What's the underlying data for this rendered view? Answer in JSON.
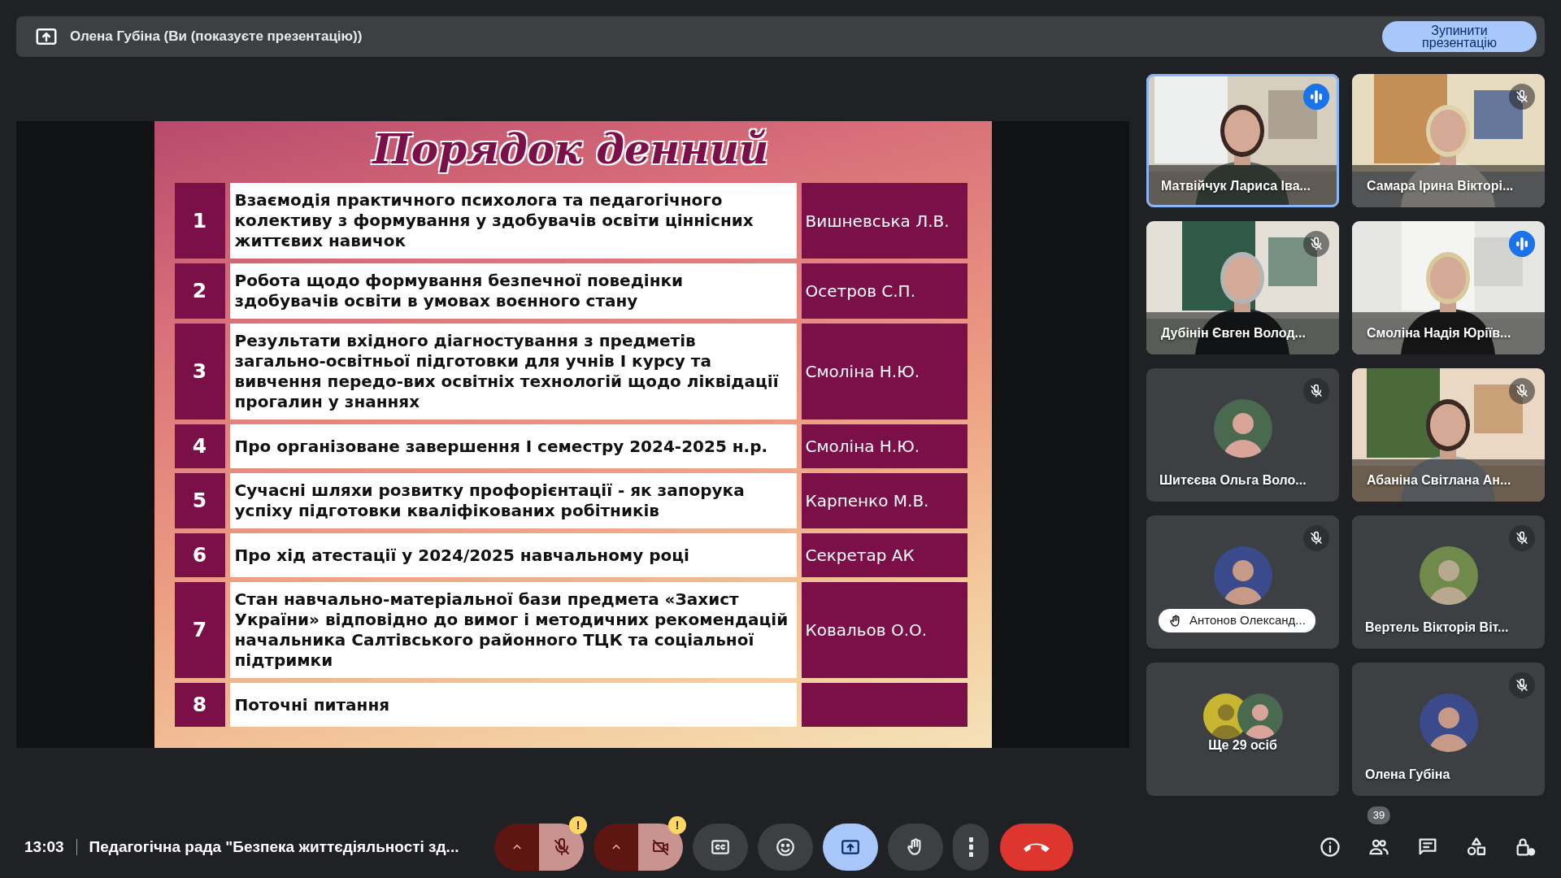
{
  "presenting_bar": {
    "text": "Олена Губіна (Ви (показуєте презентацію))",
    "stop_button": "Зупинити презентацію"
  },
  "slide": {
    "title": "Порядок денний",
    "agenda": [
      {
        "number": "1",
        "topic": "Взаємодія практичного психолога та педагогічного колективу з формування у здобувачів освіти ціннісних життєвих навичок",
        "speaker": "Вишневська Л.В."
      },
      {
        "number": "2",
        "topic": "Робота щодо формування безпечної поведінки здобувачів освіти в умовах воєнного стану",
        "speaker": "Осетров С.П."
      },
      {
        "number": "3",
        "topic": "Результати вхідного діагностування з предметів загально-освітньої підготовки для учнів І курсу та вивчення передо-вих освітніх технологій щодо ліквідації прогалин у знаннях",
        "speaker": "Смоліна Н.Ю."
      },
      {
        "number": "4",
        "topic": "Про організоване завершення І семестру 2024-2025 н.р.",
        "speaker": "Смоліна Н.Ю."
      },
      {
        "number": "5",
        "topic": "Сучасні шляхи розвитку профорієнтації - як запорука успіху підготовки кваліфікованих робітників",
        "speaker": "Карпенко М.В."
      },
      {
        "number": "6",
        "topic": "Про хід атестації у 2024/2025 навчальному році",
        "speaker": "Секретар АК"
      },
      {
        "number": "7",
        "topic": "Стан навчально-матеріальної бази предмета «Захист України» відповідно до вимог і методичних рекомендацій начальника Салтівського районного ТЦК та соціальної підтримки",
        "speaker": "Ковальов О.О."
      },
      {
        "number": "8",
        "topic": "Поточні питання"
      }
    ]
  },
  "participants": [
    {
      "name": "Матвійчук Лариса Іва...",
      "kind": "video",
      "speaking": true,
      "muted": false,
      "highlighted": true,
      "hand_raised": false
    },
    {
      "name": "Самара Ірина Вікторі...",
      "kind": "video",
      "speaking": false,
      "muted": true,
      "highlighted": false,
      "hand_raised": false
    },
    {
      "name": "Дубінін Євген Волод...",
      "kind": "video",
      "speaking": false,
      "muted": true,
      "highlighted": false,
      "hand_raised": false
    },
    {
      "name": "Смоліна Надія Юріїв...",
      "kind": "video",
      "speaking": true,
      "muted": false,
      "highlighted": false,
      "hand_raised": false
    },
    {
      "name": "Шитєєва Ольга Воло...",
      "kind": "avatar",
      "speaking": false,
      "muted": true,
      "highlighted": false,
      "hand_raised": false
    },
    {
      "name": "Абаніна Світлана Ан...",
      "kind": "video",
      "speaking": false,
      "muted": true,
      "highlighted": false,
      "hand_raised": false
    },
    {
      "name": "Антонов Олександ...",
      "kind": "avatar",
      "speaking": false,
      "muted": true,
      "highlighted": false,
      "hand_raised": true
    },
    {
      "name": "Вертель Вікторія Віт...",
      "kind": "avatar",
      "speaking": false,
      "muted": true,
      "highlighted": false,
      "hand_raised": false
    },
    {
      "name": "Ще 29 осіб",
      "kind": "group",
      "speaking": false,
      "muted": false,
      "highlighted": false,
      "hand_raised": false
    },
    {
      "name": "Олена Губіна",
      "kind": "avatar",
      "speaking": false,
      "muted": true,
      "highlighted": false,
      "hand_raised": false
    }
  ],
  "bottom_bar": {
    "time": "13:03",
    "meeting_title": "Педагогічна рада \"Безпека життєдіяльності зд...",
    "controls": [
      {
        "kind": "mic",
        "on": false,
        "warning": "!"
      },
      {
        "kind": "camera",
        "on": false,
        "warning": "!"
      },
      {
        "kind": "captions",
        "on": false
      },
      {
        "kind": "reactions"
      },
      {
        "kind": "present",
        "on": true
      },
      {
        "kind": "hand",
        "on": false
      },
      {
        "kind": "more"
      },
      {
        "kind": "leave"
      }
    ],
    "side": [
      {
        "kind": "info"
      },
      {
        "kind": "people",
        "badge": "39"
      },
      {
        "kind": "chat"
      },
      {
        "kind": "activities"
      },
      {
        "kind": "host"
      }
    ]
  }
}
